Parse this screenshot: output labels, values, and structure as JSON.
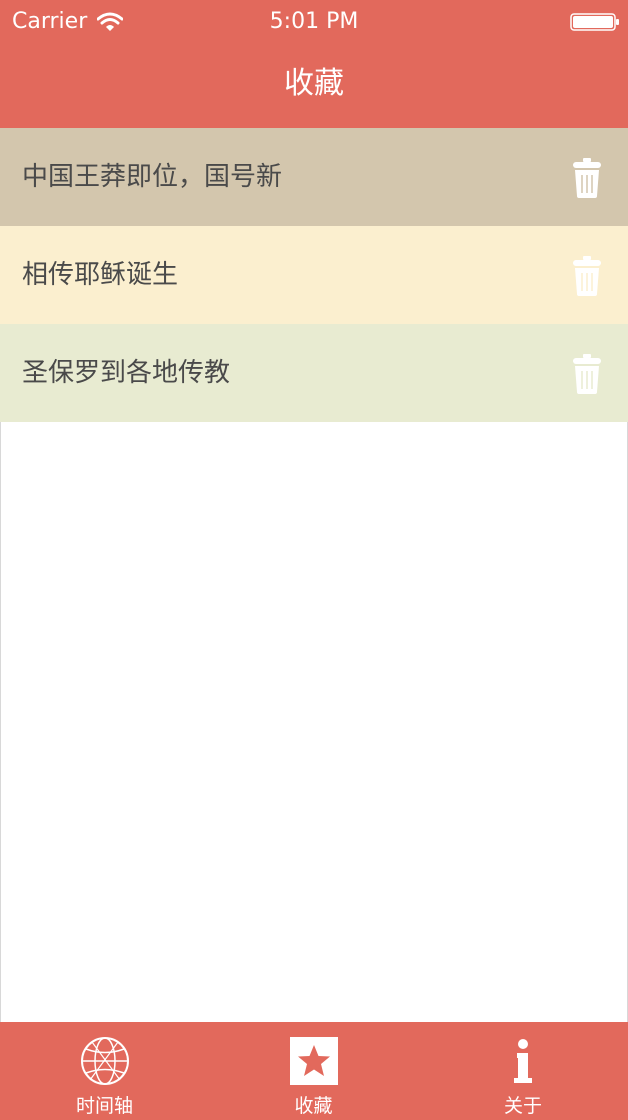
{
  "status_bar": {
    "carrier": "Carrier",
    "time": "5:01 PM"
  },
  "nav": {
    "title": "收藏"
  },
  "favorites": [
    {
      "label": "中国王莽即位，国号新",
      "bg": "#d3c6ad"
    },
    {
      "label": "相传耶稣诞生",
      "bg": "#fbefcf"
    },
    {
      "label": "圣保罗到各地传教",
      "bg": "#e8ebd1"
    }
  ],
  "tabs": [
    {
      "label": "时间轴",
      "icon": "globe-icon"
    },
    {
      "label": "收藏",
      "icon": "star-icon"
    },
    {
      "label": "关于",
      "icon": "info-icon"
    }
  ],
  "colors": {
    "accent": "#e2695c",
    "text": "#4a4a4a",
    "icon": "#ffffff"
  }
}
